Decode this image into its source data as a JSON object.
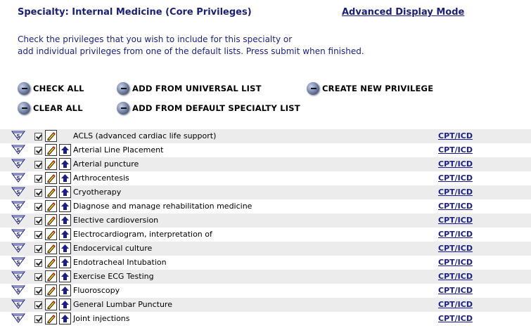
{
  "header": {
    "title": "Specialty: Internal Medicine (Core Privileges)",
    "advanced_link": "Advanced Display Mode"
  },
  "instructions": {
    "line1": "Check the privileges that you wish to include for this specialty or",
    "line2": "add individual privileges from one of the default lists. Press submit when finished."
  },
  "actions": {
    "check_all": "CHECK ALL",
    "clear_all": "CLEAR ALL",
    "add_universal": "ADD FROM UNIVERSAL LIST",
    "add_default": "ADD FROM DEFAULT SPECIALTY LIST",
    "create_new": "CREATE NEW PRIVILEGE"
  },
  "privileges": [
    {
      "name": "ACLS (advanced cardiac life support)",
      "link": "CPT/ICD",
      "checked": true,
      "has_move": false
    },
    {
      "name": "Arterial Line Placement",
      "link": "CPT/ICD",
      "checked": true,
      "has_move": true
    },
    {
      "name": "Arterial puncture",
      "link": "CPT/ICD",
      "checked": true,
      "has_move": true
    },
    {
      "name": "Arthrocentesis",
      "link": "CPT/ICD",
      "checked": true,
      "has_move": true
    },
    {
      "name": "Cryotherapy",
      "link": "CPT/ICD",
      "checked": true,
      "has_move": true
    },
    {
      "name": "Diagnose and manage rehabilitation medicine",
      "link": "CPT/ICD",
      "checked": true,
      "has_move": true
    },
    {
      "name": "Elective cardioversion",
      "link": "CPT/ICD",
      "checked": true,
      "has_move": true
    },
    {
      "name": "Electrocardiogram, interpretation of",
      "link": "CPT/ICD",
      "checked": true,
      "has_move": true
    },
    {
      "name": "Endocervical culture",
      "link": "CPT/ICD",
      "checked": true,
      "has_move": true
    },
    {
      "name": "Endotracheal Intubation",
      "link": "CPT/ICD",
      "checked": true,
      "has_move": true
    },
    {
      "name": "Exercise ECG Testing",
      "link": "CPT/ICD",
      "checked": true,
      "has_move": true
    },
    {
      "name": "Fluoroscopy",
      "link": "CPT/ICD",
      "checked": true,
      "has_move": true
    },
    {
      "name": "General Lumbar Puncture",
      "link": "CPT/ICD",
      "checked": true,
      "has_move": true
    },
    {
      "name": "Joint injections",
      "link": "CPT/ICD",
      "checked": true,
      "has_move": true
    }
  ],
  "colors": {
    "text_blue": "#1a1f8a",
    "row_alt": "#ececec"
  }
}
